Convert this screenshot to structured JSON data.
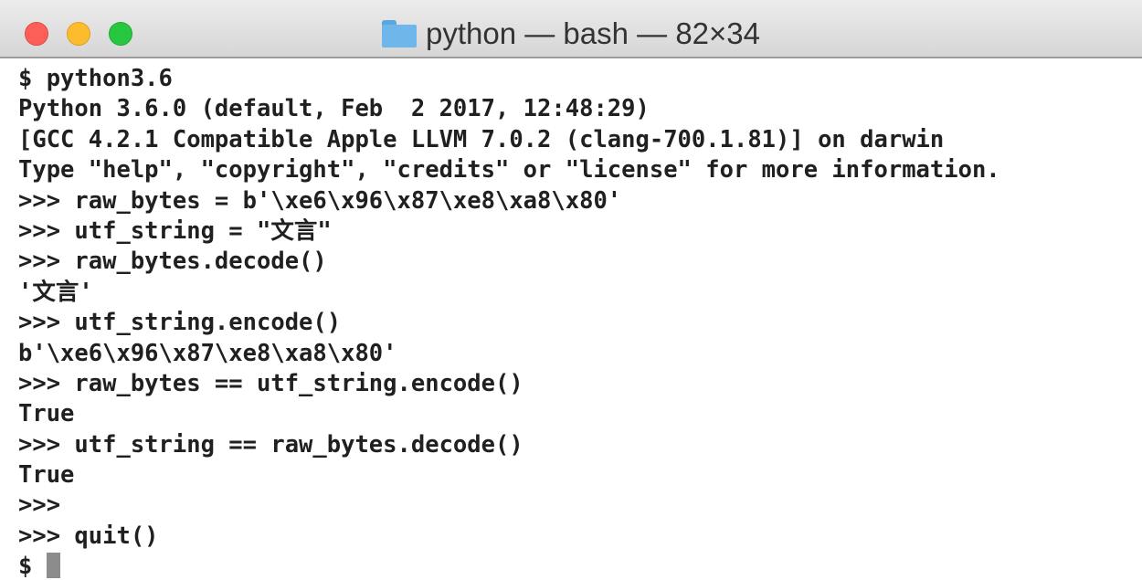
{
  "window": {
    "title": "python — bash — 82×34"
  },
  "terminal": {
    "lines": [
      "$ python3.6",
      "Python 3.6.0 (default, Feb  2 2017, 12:48:29)",
      "[GCC 4.2.1 Compatible Apple LLVM 7.0.2 (clang-700.1.81)] on darwin",
      "Type \"help\", \"copyright\", \"credits\" or \"license\" for more information.",
      ">>> raw_bytes = b'\\xe6\\x96\\x87\\xe8\\xa8\\x80'",
      ">>> utf_string = \"文言\"",
      ">>> raw_bytes.decode()",
      "'文言'",
      ">>> utf_string.encode()",
      "b'\\xe6\\x96\\x87\\xe8\\xa8\\x80'",
      ">>> raw_bytes == utf_string.encode()",
      "True",
      ">>> utf_string == raw_bytes.decode()",
      "True",
      ">>>",
      ">>> quit()",
      "$"
    ]
  },
  "icons": {
    "title_icon": "folder-icon",
    "cursor": "cursor-block"
  },
  "colors": {
    "close": "#fc5f57",
    "minimize": "#fdbb2e",
    "zoom": "#27c840",
    "folder": "#6fb7ea",
    "text": "#202020",
    "cursor": "#8c8c8c"
  }
}
